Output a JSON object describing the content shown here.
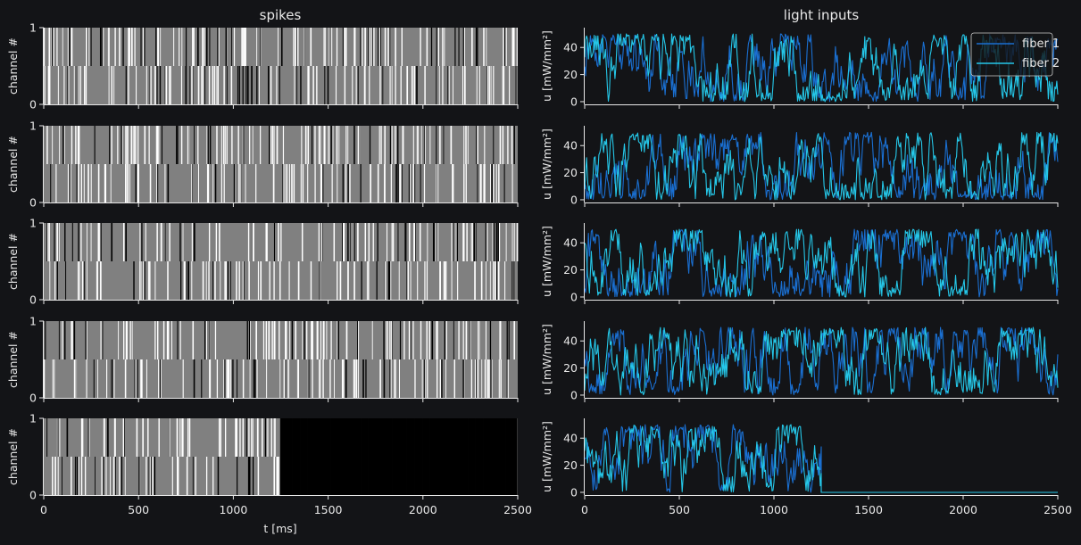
{
  "colors": {
    "background": "#131417",
    "spike_panel": "#808080",
    "spike_white": "#ffffff",
    "spike_black": "#000000",
    "fiber1": "#1a6fd1",
    "fiber2": "#25c7e8",
    "axis": "#e8e8e8"
  },
  "chart_data": [
    {
      "type": "raster",
      "title": "spikes",
      "ylabel": "channel #",
      "xlabel": "t [ms]",
      "xlim": [
        0,
        2500
      ],
      "ylim": [
        0,
        1
      ],
      "xticks": [
        "0",
        "500",
        "1000",
        "1500",
        "2000",
        "2500"
      ],
      "yticks": [
        "0",
        "1"
      ],
      "rows": [
        {
          "channel1_spike_density_per_s": 55,
          "channel0_spike_density_per_s": 45
        },
        {
          "channel1_spike_density_per_s": 50,
          "channel0_spike_density_per_s": 45
        },
        {
          "channel1_spike_density_per_s": 45,
          "channel0_spike_density_per_s": 40
        },
        {
          "channel1_spike_density_per_s": 45,
          "channel0_spike_density_per_s": 45
        },
        {
          "channel1_spike_density_per_s": 45,
          "channel0_spike_density_per_s": 40,
          "regular_after_ms": 1250,
          "regular_interval_ms": 5
        }
      ]
    },
    {
      "type": "line",
      "title": "light inputs",
      "ylabel": "u [mW/mm²]",
      "xlim": [
        0,
        2500
      ],
      "ylim": [
        -2,
        52
      ],
      "xticks": [
        "0",
        "500",
        "1000",
        "1500",
        "2000",
        "2500"
      ],
      "yticks": [
        "0",
        "20",
        "40"
      ],
      "legend": {
        "location": "top-right",
        "entries": [
          "fiber 1",
          "fiber 2"
        ]
      },
      "series": [
        {
          "name": "fiber 1",
          "range": [
            0,
            50
          ],
          "sample_interval_ms": 5
        },
        {
          "name": "fiber 2",
          "range": [
            0,
            50
          ],
          "sample_interval_ms": 5
        }
      ],
      "rows": [
        {
          "active_until_ms": 2500
        },
        {
          "active_until_ms": 2500
        },
        {
          "active_until_ms": 2500
        },
        {
          "active_until_ms": 2500
        },
        {
          "active_until_ms": 1250,
          "value_after": 0
        }
      ]
    }
  ]
}
